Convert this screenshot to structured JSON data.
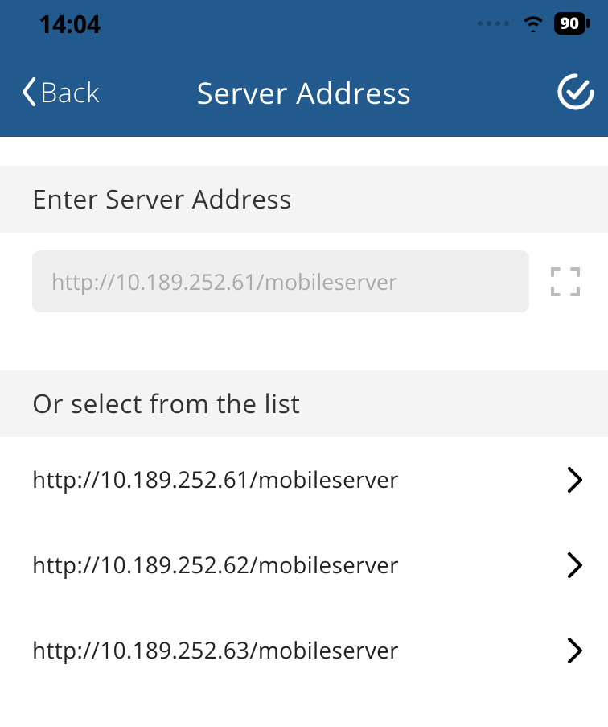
{
  "status": {
    "time": "14:04",
    "battery": "90"
  },
  "nav": {
    "back_label": "Back",
    "title": "Server Address"
  },
  "sections": {
    "enter_label": "Enter Server Address",
    "input_placeholder": "http://10.189.252.61/mobileserver",
    "list_label": "Or select from the list"
  },
  "servers": [
    "http://10.189.252.61/mobileserver",
    "http://10.189.252.62/mobileserver",
    "http://10.189.252.63/mobileserver"
  ]
}
